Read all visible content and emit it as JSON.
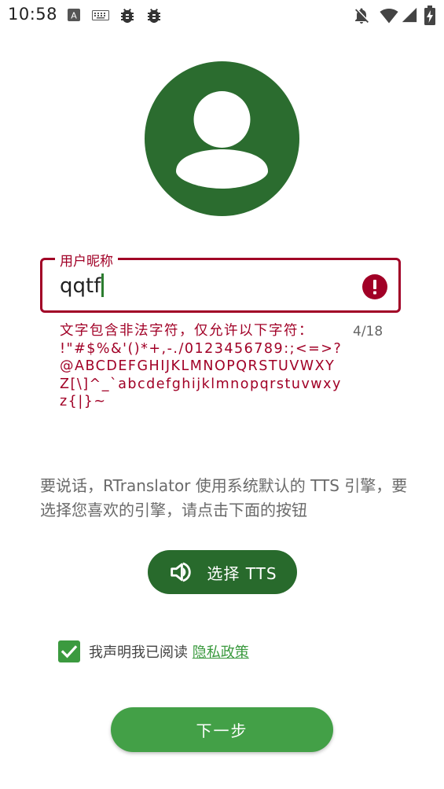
{
  "status_bar": {
    "time": "10:58",
    "icons": [
      "a-box-icon",
      "keyboard-icon",
      "bug-icon",
      "bug-icon",
      "notifications-off-icon",
      "wifi-icon",
      "signal-icon",
      "battery-charging-icon"
    ]
  },
  "avatar": {
    "icon": "account-circle-icon",
    "color": "#2b6c2f"
  },
  "nickname_field": {
    "label": "用户昵称",
    "value": "qqtf",
    "error_icon": "error-icon",
    "error_message": "文字包含非法字符，仅允许以下字符： !\"#$%&'()*+,-./0123456789:;<=>?@ABCDEFGHIJKLMNOPQRSTUVWXYZ[\\]^_`abcdefghijklmnopqrstuvwxyz{|}~",
    "counter": "4/18",
    "error_color": "#a10026"
  },
  "tts_info": "要说话，RTranslator 使用系统默认的 TTS 引擎，要选择您喜欢的引擎，请点击下面的按钮",
  "tts_button": {
    "icon": "volume-up-icon",
    "label": "选择 TTS"
  },
  "consent": {
    "checked": true,
    "text": "我声明我已阅读 ",
    "link": "隐私政策"
  },
  "next_button": {
    "label": "下一步"
  },
  "colors": {
    "primary_dark": "#286a2c",
    "primary": "#43a047",
    "error": "#a10026"
  }
}
